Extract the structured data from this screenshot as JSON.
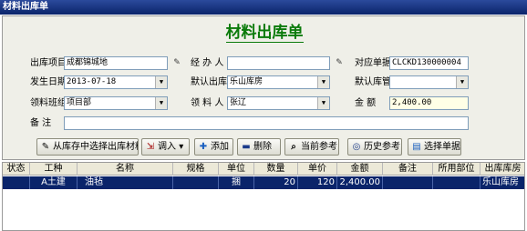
{
  "window": {
    "title": "材料出库单"
  },
  "form": {
    "heading": "材料出库单",
    "fields": {
      "project": {
        "label": "出库项目",
        "value": "成都锦城地"
      },
      "handler": {
        "label": "经 办 人",
        "value": ""
      },
      "ref_no": {
        "label": "对应单据",
        "value": "CLCKD130000004"
      },
      "date": {
        "label": "发生日期",
        "value": "2013-07-18"
      },
      "warehouse": {
        "label": "默认出库",
        "value": "乐山库房"
      },
      "keeper": {
        "label": "默认库管",
        "value": ""
      },
      "team": {
        "label": "领料班组",
        "value": "项目部"
      },
      "receiver": {
        "label": "领 料 人",
        "value": "张辽"
      },
      "amount": {
        "label": "金 额",
        "value": "2,400.00"
      },
      "remark": {
        "label": "备 注",
        "value": ""
      }
    }
  },
  "toolbar": {
    "from_stock": "从库存中选择出库材料",
    "import": "调入",
    "add": "添加",
    "delete": "删除",
    "current_ref": "当前参考",
    "history_ref": "历史参考",
    "select_doc": "选择单据"
  },
  "table": {
    "columns": [
      "状态",
      "工种",
      "名称",
      "规格",
      "单位",
      "数量",
      "单价",
      "金额",
      "备注",
      "所用部位",
      "出库库房"
    ],
    "rows": [
      {
        "status": "",
        "trade": "A土建",
        "name": "油毡",
        "spec": "",
        "unit": "捆",
        "qty": "20",
        "price": "120",
        "amount": "2,400.00",
        "note": "",
        "part": "",
        "store": "乐山库房"
      }
    ]
  }
}
